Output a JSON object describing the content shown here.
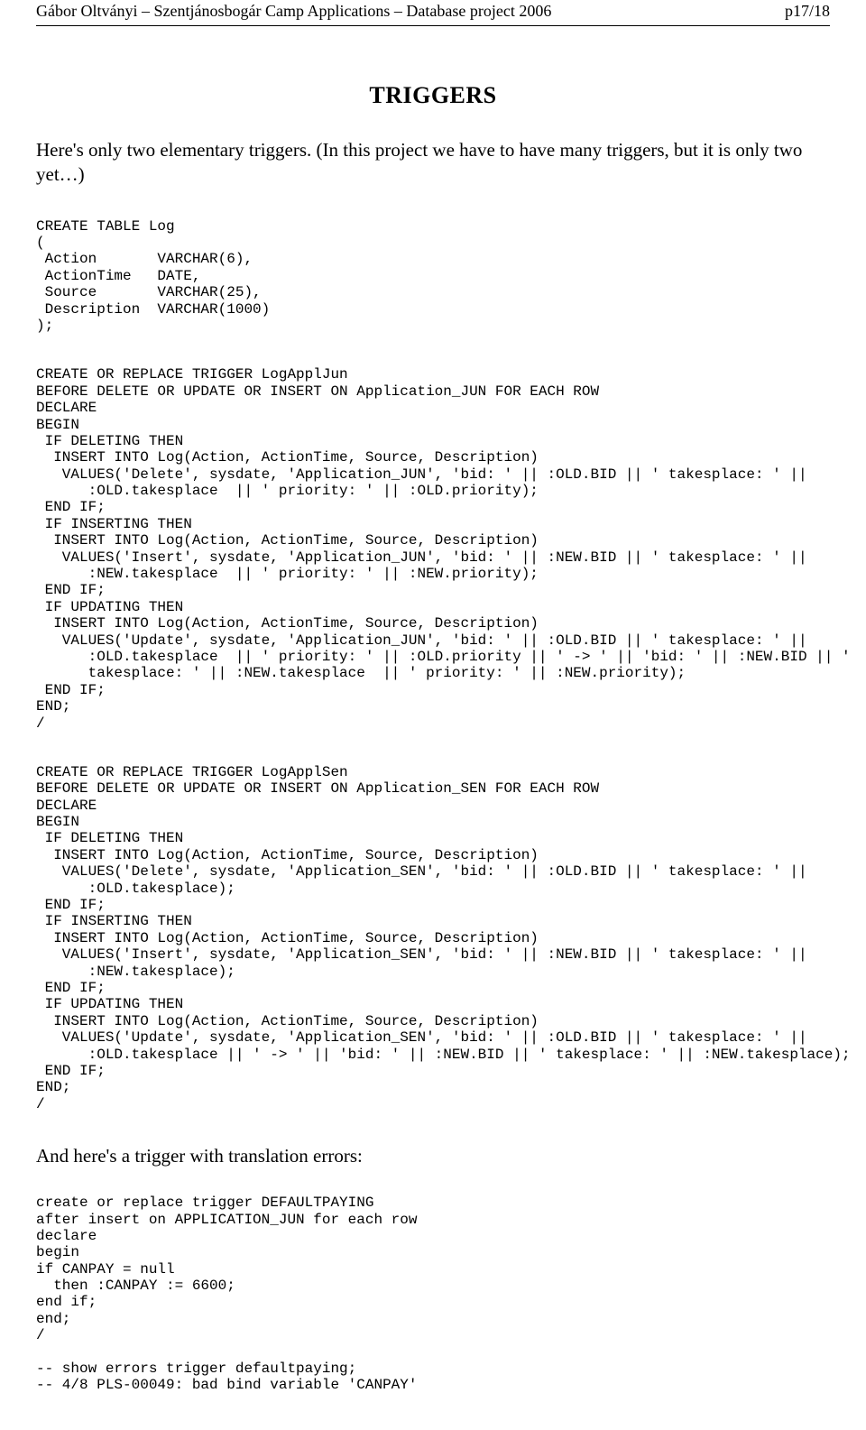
{
  "header": {
    "left": "Gábor Oltványi – Szentjánosbogár Camp Applications – Database project 2006",
    "right": "p17/18"
  },
  "title": "TRIGGERS",
  "intro": "Here's only two elementary triggers. (In this project we have to have many triggers, but it is only two yet…)",
  "code1": "CREATE TABLE Log\n(\n Action       VARCHAR(6),\n ActionTime   DATE,\n Source       VARCHAR(25),\n Description  VARCHAR(1000)\n);",
  "code2": "CREATE OR REPLACE TRIGGER LogApplJun\nBEFORE DELETE OR UPDATE OR INSERT ON Application_JUN FOR EACH ROW\nDECLARE\nBEGIN\n IF DELETING THEN\n  INSERT INTO Log(Action, ActionTime, Source, Description)\n   VALUES('Delete', sysdate, 'Application_JUN', 'bid: ' || :OLD.BID || ' takesplace: ' ||\n      :OLD.takesplace  || ' priority: ' || :OLD.priority);\n END IF;\n IF INSERTING THEN\n  INSERT INTO Log(Action, ActionTime, Source, Description)\n   VALUES('Insert', sysdate, 'Application_JUN', 'bid: ' || :NEW.BID || ' takesplace: ' ||\n      :NEW.takesplace  || ' priority: ' || :NEW.priority);\n END IF;\n IF UPDATING THEN\n  INSERT INTO Log(Action, ActionTime, Source, Description)\n   VALUES('Update', sysdate, 'Application_JUN', 'bid: ' || :OLD.BID || ' takesplace: ' ||\n      :OLD.takesplace  || ' priority: ' || :OLD.priority || ' -> ' || 'bid: ' || :NEW.BID || '\n      takesplace: ' || :NEW.takesplace  || ' priority: ' || :NEW.priority);\n END IF;\nEND;\n/",
  "code3": "CREATE OR REPLACE TRIGGER LogApplSen\nBEFORE DELETE OR UPDATE OR INSERT ON Application_SEN FOR EACH ROW\nDECLARE\nBEGIN\n IF DELETING THEN\n  INSERT INTO Log(Action, ActionTime, Source, Description)\n   VALUES('Delete', sysdate, 'Application_SEN', 'bid: ' || :OLD.BID || ' takesplace: ' ||\n      :OLD.takesplace);\n END IF;\n IF INSERTING THEN\n  INSERT INTO Log(Action, ActionTime, Source, Description)\n   VALUES('Insert', sysdate, 'Application_SEN', 'bid: ' || :NEW.BID || ' takesplace: ' ||\n      :NEW.takesplace);\n END IF;\n IF UPDATING THEN\n  INSERT INTO Log(Action, ActionTime, Source, Description)\n   VALUES('Update', sysdate, 'Application_SEN', 'bid: ' || :OLD.BID || ' takesplace: ' ||\n      :OLD.takesplace || ' -> ' || 'bid: ' || :NEW.BID || ' takesplace: ' || :NEW.takesplace);\n END IF;\nEND;\n/",
  "note": "And here's a trigger with translation errors:",
  "code4": "create or replace trigger DEFAULTPAYING\nafter insert on APPLICATION_JUN for each row\ndeclare\nbegin\nif CANPAY = null\n  then :CANPAY := 6600;\nend if;\nend;\n/\n\n-- show errors trigger defaultpaying;\n-- 4/8 PLS-00049: bad bind variable 'CANPAY'"
}
